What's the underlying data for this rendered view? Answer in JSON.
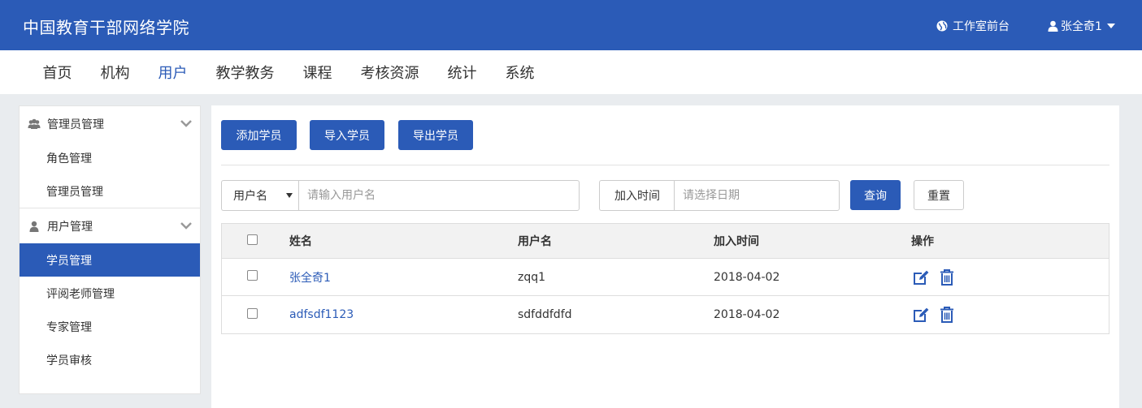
{
  "header": {
    "brand": "中国教育干部网络学院",
    "front_link": "工作室前台",
    "user_name": "张全奇1",
    "icons": {
      "front": "globe-icon",
      "user": "user-icon"
    }
  },
  "nav": {
    "items": [
      {
        "label": "首页",
        "active": false
      },
      {
        "label": "机构",
        "active": false
      },
      {
        "label": "用户",
        "active": true
      },
      {
        "label": "教学教务",
        "active": false
      },
      {
        "label": "课程",
        "active": false
      },
      {
        "label": "考核资源",
        "active": false
      },
      {
        "label": "统计",
        "active": false
      },
      {
        "label": "系统",
        "active": false
      }
    ]
  },
  "sidebar": {
    "sections": [
      {
        "label": "管理员管理",
        "icon": "users-icon",
        "items": [
          "角色管理",
          "管理员管理"
        ]
      },
      {
        "label": "用户管理",
        "icon": "user-icon",
        "items": [
          "学员管理",
          "评阅老师管理",
          "专家管理",
          "学员审核"
        ]
      }
    ],
    "active_item": "学员管理"
  },
  "toolbar": {
    "add": "添加学员",
    "import": "导入学员",
    "export": "导出学员"
  },
  "search": {
    "field_select": "用户名",
    "keyword_placeholder": "请输入用户名",
    "date_label": "加入时间",
    "date_placeholder": "请选择日期",
    "query": "查询",
    "reset": "重置"
  },
  "table": {
    "columns": [
      "姓名",
      "用户名",
      "加入时间",
      "操作"
    ],
    "rows": [
      {
        "name": "张全奇1",
        "username": "zqq1",
        "joined": "2018-04-02"
      },
      {
        "name": "adfsdf1123",
        "username": "sdfddfdfd",
        "joined": "2018-04-02"
      }
    ],
    "action_icons": [
      "edit-icon",
      "delete-icon"
    ]
  },
  "colors": {
    "primary": "#2b5bb7",
    "background": "#e9ecef"
  }
}
